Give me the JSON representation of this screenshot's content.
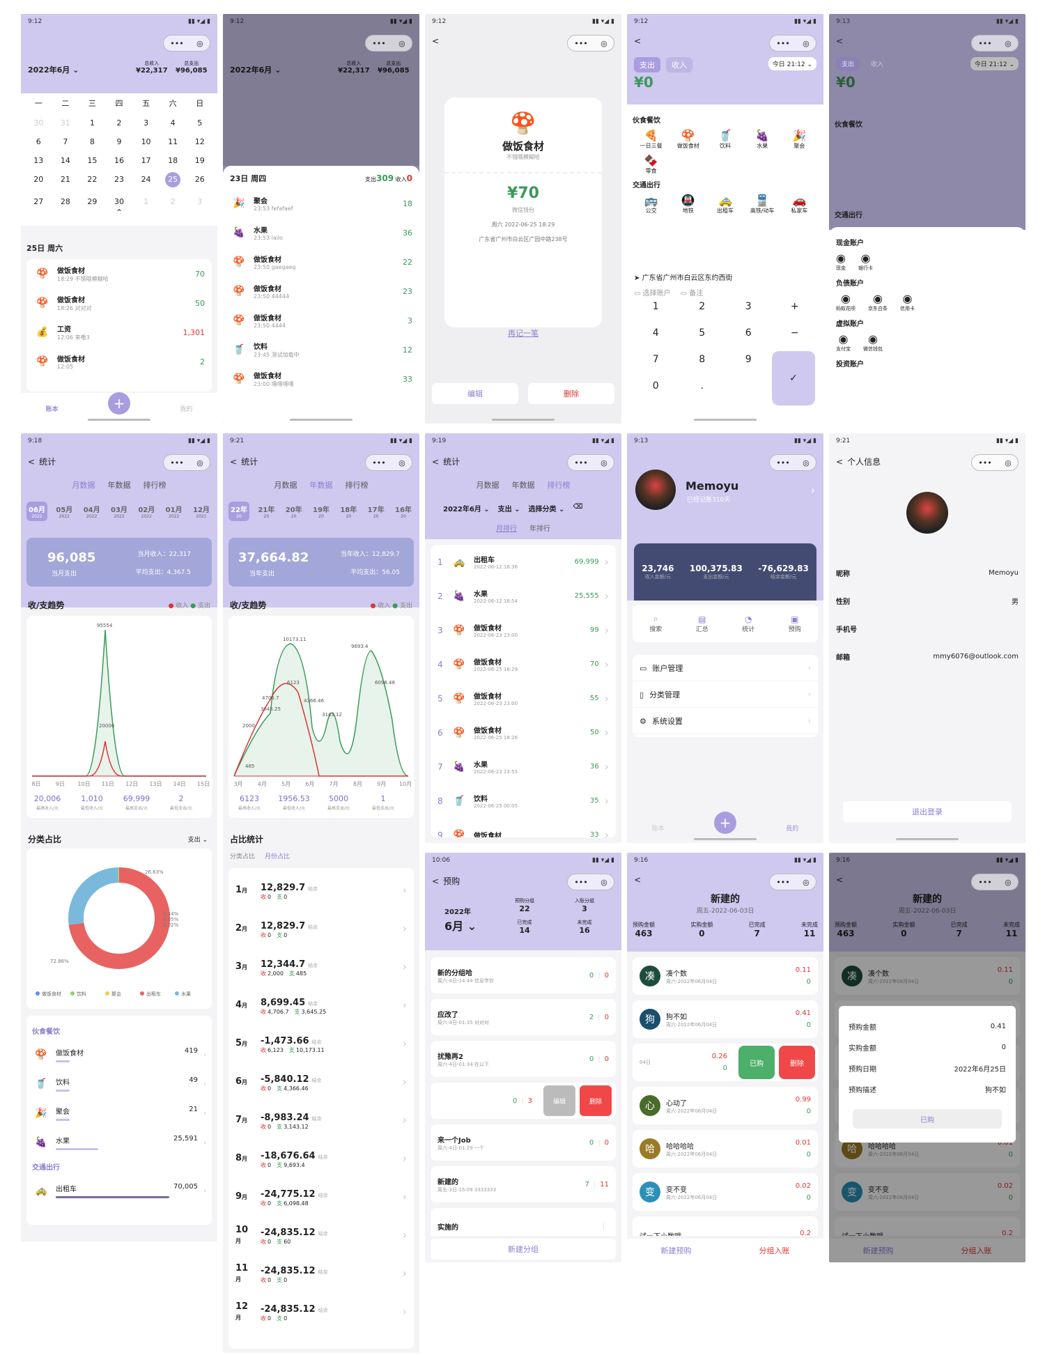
{
  "app": {
    "status_time_a": "9:12",
    "status_time_b": "9:13",
    "status_time_c": "9:18",
    "status_time_d": "9:21",
    "status_time_e": "9:19",
    "status_time_f": "10:06",
    "status_time_g": "9:16"
  },
  "common": {
    "dots": "•••",
    "target": "◎",
    "back": "<",
    "expense": "支出",
    "income": "收入",
    "home_tab": "账本",
    "mine_tab": "我的",
    "plus": "+"
  },
  "calendar": {
    "month": "2022年6月",
    "total_income_label": "总收入",
    "total_income": "¥22,317",
    "total_expense_label": "总支出",
    "total_expense": "¥96,085",
    "weekdays": [
      "一",
      "二",
      "三",
      "四",
      "五",
      "六",
      "日"
    ],
    "days": [
      "30",
      "31",
      "1",
      "2",
      "3",
      "4",
      "5",
      "6",
      "7",
      "8",
      "9",
      "10",
      "11",
      "12",
      "13",
      "14",
      "15",
      "16",
      "17",
      "18",
      "19",
      "20",
      "21",
      "22",
      "23",
      "24",
      "25",
      "26",
      "27",
      "28",
      "29",
      "30",
      "1",
      "2",
      "3"
    ],
    "selected_day": "25",
    "date_header": "25日 周六",
    "items": [
      {
        "name": "做饭食材",
        "note": "18:29 不错哦模糊哈",
        "amount": "70"
      },
      {
        "name": "做饭食材",
        "note": "18:26 对对对",
        "amount": "50"
      },
      {
        "name": "工资",
        "note": "12:06 来嘞3",
        "amount": "1,301"
      },
      {
        "name": "做饭食材",
        "note": "12:05",
        "amount": "2"
      }
    ]
  },
  "sheet": {
    "date": "23日 周四",
    "expense_label": "支出",
    "expense": "309",
    "income_label": "收入",
    "income": "0",
    "items": [
      {
        "name": "聚会",
        "note": "23:53 fefafaef",
        "amount": "18"
      },
      {
        "name": "水果",
        "note": "23:53 lailo",
        "amount": "36"
      },
      {
        "name": "做饭食材",
        "note": "23:50 gaegaeg",
        "amount": "22"
      },
      {
        "name": "做饭食材",
        "note": "23:50 44444",
        "amount": "23"
      },
      {
        "name": "做饭食材",
        "note": "23:50 4444",
        "amount": "3"
      },
      {
        "name": "饮料",
        "note": "23:45 测试加载中",
        "amount": "12"
      },
      {
        "name": "做饭食材",
        "note": "23:00 嘿嘿嘿嘿",
        "amount": "33"
      }
    ]
  },
  "detail": {
    "category": "做饭食材",
    "desc": "不错哦模糊哈",
    "amount": "¥70",
    "account": "微信钱包",
    "time": "周六 2022-06-25 18:29",
    "address": "广东省广州市白云区广园中路238号",
    "again": "再记一笔",
    "edit": "编辑",
    "delete": "删除"
  },
  "add": {
    "time": "今日 21:12",
    "amount": "¥0",
    "group1": "伙食餐饮",
    "items1": [
      "一日三餐",
      "做饭食材",
      "饮料",
      "水果",
      "聚会",
      "零食"
    ],
    "group2": "交通出行",
    "items2": [
      "公交",
      "地铁",
      "出租车",
      "高铁/动车",
      "私家车"
    ],
    "location": "广东省广州市白云区东约西街",
    "choose_account": "选择账户",
    "remark": "备注",
    "keys": [
      "1",
      "2",
      "3",
      "+",
      "4",
      "5",
      "6",
      "−",
      "7",
      "8",
      "9",
      "⌫",
      "0",
      "."
    ],
    "ok": "✓"
  },
  "accounts": {
    "cash_title": "现金账户",
    "cash": [
      "现金",
      "银行卡"
    ],
    "debt_title": "负债账户",
    "debt": [
      "蚂蚁花呗",
      "京东白条",
      "信用卡"
    ],
    "virtual_title": "虚拟账户",
    "virtual": [
      "支付宝",
      "微信钱包"
    ],
    "more": "投资账户"
  },
  "stats1": {
    "title": "统计",
    "tabs": [
      "月数据",
      "年数据",
      "排行榜"
    ],
    "months": [
      [
        "06月",
        "2022"
      ],
      [
        "05月",
        "2022"
      ],
      [
        "04月",
        "2022"
      ],
      [
        "03月",
        "2022"
      ],
      [
        "02月",
        "2022"
      ],
      [
        "01月",
        "2022"
      ],
      [
        "12月",
        "2021"
      ]
    ],
    "total": "96,085",
    "total_label": "当月支出",
    "income": "当月收入：22,317",
    "avg": "平均支出：4,367.5",
    "trend": "收/支趋势",
    "peak": "95554",
    "peak2": "20006",
    "xlabels": [
      "8日",
      "9日",
      "10日",
      "11日",
      "12日",
      "13日",
      "14日",
      "15日"
    ],
    "kpis": [
      [
        "20,006",
        "最高收入/元"
      ],
      [
        "1,010",
        "最低收入/元"
      ],
      [
        "69,999",
        "最高支出/元"
      ],
      [
        "2",
        "最低支出/元"
      ]
    ],
    "cat_title": "分类占比",
    "cat_sel": "支出",
    "pcts": [
      "26.63%",
      "0.44%",
      "0.05%",
      "0.02%",
      "72.86%"
    ],
    "legend": [
      "做饭食材",
      "饮料",
      "聚会",
      "出租车",
      "水果"
    ],
    "g1": "伙食餐饮",
    "rows": [
      [
        "做饭食材",
        "419"
      ],
      [
        "饮料",
        "49"
      ],
      [
        "聚会",
        "21"
      ],
      [
        "水果",
        "25,591"
      ]
    ],
    "g2": "交通出行",
    "rows2": [
      [
        "出租车",
        "70,005"
      ]
    ]
  },
  "stats2": {
    "months": [
      [
        "22年",
        "20"
      ],
      [
        "21年",
        "20"
      ],
      [
        "20年",
        "20"
      ],
      [
        "19年",
        "20"
      ],
      [
        "18年",
        "20"
      ],
      [
        "17年",
        "20"
      ],
      [
        "16年",
        "20"
      ]
    ],
    "total": "37,664.82",
    "total_label": "当年支出",
    "income": "当年收入：12,829.7",
    "avg": "平均支出：56.05",
    "labels": [
      "10173.11",
      "9693.4",
      "6123",
      "6098.48",
      "4706.7",
      "4366.46",
      "3645.25",
      "3143.12",
      "2000",
      "485"
    ],
    "xlabels": [
      "3月",
      "4月",
      "5月",
      "6月",
      "7月",
      "8月",
      "9月",
      "10月"
    ],
    "kpis": [
      [
        "6123",
        "最高收入/元"
      ],
      [
        "1956.53",
        "最低收入/元"
      ],
      [
        "5000",
        "最高支出/元"
      ],
      [
        "1",
        "最低支出/元"
      ]
    ],
    "title": "占比统计",
    "subtabs": [
      "分类占比",
      "月份占比"
    ],
    "months_list": [
      [
        "1",
        "12,829.7",
        "0",
        "0"
      ],
      [
        "2",
        "12,829.7",
        "0",
        "0"
      ],
      [
        "3",
        "12,344.7",
        "2,000",
        "485"
      ],
      [
        "4",
        "8,699.45",
        "4,706.7",
        "3,645.25"
      ],
      [
        "5",
        "-1,473.66",
        "6,123",
        "10,173.11"
      ],
      [
        "6",
        "-5,840.12",
        "0",
        "4,366.46"
      ],
      [
        "7",
        "-8,983.24",
        "0",
        "3,143.12"
      ],
      [
        "8",
        "-18,676.64",
        "0",
        "9,693.4"
      ],
      [
        "9",
        "-24,775.12",
        "0",
        "6,098.48"
      ],
      [
        "10",
        "-24,835.12",
        "0",
        "60"
      ],
      [
        "11",
        "-24,835.12",
        "0",
        "0"
      ],
      [
        "12",
        "-24,835.12",
        "0",
        "0"
      ]
    ],
    "bal": "结余",
    "inc": "收",
    "exp": "支",
    "unit": "月"
  },
  "rank": {
    "filters": [
      "2022年6月",
      "支出",
      "选择分类"
    ],
    "tabs": [
      "月排行",
      "年排行"
    ],
    "items": [
      [
        "1",
        "出租车",
        "2022-06-12 16:36",
        "69,999"
      ],
      [
        "2",
        "水果",
        "2022-06-12 16:54",
        "25,555"
      ],
      [
        "3",
        "做饭食材",
        "2022-06-23 23:00",
        "99"
      ],
      [
        "4",
        "做饭食材",
        "2022-06-25 18:29",
        "70"
      ],
      [
        "5",
        "做饭食材",
        "2022-06-23 23:00",
        "55"
      ],
      [
        "6",
        "做饭食材",
        "2022-06-25 18:26",
        "50"
      ],
      [
        "7",
        "水果",
        "2022-06-23 23:53",
        "36"
      ],
      [
        "8",
        "饮料",
        "2022-06-25 00:05",
        "35"
      ],
      [
        "9",
        "做饭食材",
        "",
        "33"
      ]
    ]
  },
  "mine": {
    "name": "Memoyu",
    "since": "已经记账310天",
    "v1": "23,746",
    "l1": "收入金额/元",
    "v2": "100,375.83",
    "l2": "支出金额/元",
    "v3": "-76,629.83",
    "l3": "结余金额/元",
    "tools": [
      "搜索",
      "汇总",
      "统计",
      "预购"
    ],
    "menu": [
      "账户管理",
      "分类管理",
      "系统设置"
    ]
  },
  "profile": {
    "title": "个人信息",
    "rows": [
      [
        "昵称",
        "Memoyu"
      ],
      [
        "性别",
        "男"
      ],
      [
        "手机号",
        ""
      ],
      [
        "邮箱",
        "mmy6076@outlook.com"
      ]
    ],
    "logout": "退出登录"
  },
  "prebuy": {
    "title": "预购",
    "year": "2022年",
    "month": "6月",
    "s": [
      [
        "预购分组",
        "22"
      ],
      [
        "入账分组",
        "3"
      ],
      [
        "已完成",
        "14"
      ],
      [
        "未完成",
        "16"
      ]
    ],
    "items": [
      [
        "新的分组哈",
        "周六-4日-14:44 信息学你",
        "0",
        "0"
      ],
      [
        "应改了",
        "周六-4日-01:35 对对对",
        "2",
        "0"
      ],
      [
        "扰豫再2",
        "周六-4日-01:34 在以下",
        "0",
        "0"
      ],
      [
        "",
        "",
        "0",
        "3"
      ],
      [
        "来一个Job",
        "周六-4日-01:29 一个",
        "0",
        "0"
      ],
      [
        "新建的",
        "周五-3日-15:09 3333333",
        "7",
        "11"
      ],
      [
        "实施的",
        "",
        "",
        " "
      ]
    ],
    "edit": "编辑",
    "del": "删除",
    "new_group": "新建分组"
  },
  "group": {
    "title": "新建的",
    "date": "周五-2022-06-03日",
    "s": [
      [
        "预购金额",
        "463"
      ],
      [
        "实购金额",
        "0"
      ],
      [
        "已完成",
        "7"
      ],
      [
        "未完成",
        "11"
      ]
    ],
    "items": [
      [
        "凑",
        "凑个数",
        "周六-2022年06月04日",
        "0.11",
        "0",
        "#1e4d3c"
      ],
      [
        "狗",
        "狗不如",
        "周六-2022年06月04日",
        "0.41",
        "0",
        "#1a4f6e"
      ],
      [
        "",
        "",
        "04日",
        "0.26",
        "0",
        ""
      ],
      [
        "心",
        "心动了",
        "周六-2022年06月04日",
        "0.99",
        "0",
        "#4a6b2a"
      ],
      [
        "哈",
        "哈哈哈哈",
        "周六-2022年06月04日",
        "0.01",
        "0",
        "#9a7a24"
      ],
      [
        "变",
        "变不变",
        "周六-2022年06月04日",
        "0.02",
        "0",
        "#2b90b8"
      ],
      [
        "试",
        "试一下小数哦",
        "",
        "0.2",
        "",
        ""
      ]
    ],
    "bought": "已购",
    "del": "删除",
    "new_prebuy": "新建预购",
    "to_account": "分组入账",
    "modal": [
      [
        "预购金额",
        "0.41"
      ],
      [
        "实购金额",
        "0"
      ],
      [
        "预购日期",
        "2022年6月25日"
      ],
      [
        "预购描述",
        "狗不如"
      ]
    ],
    "modal_btn": "已购"
  }
}
